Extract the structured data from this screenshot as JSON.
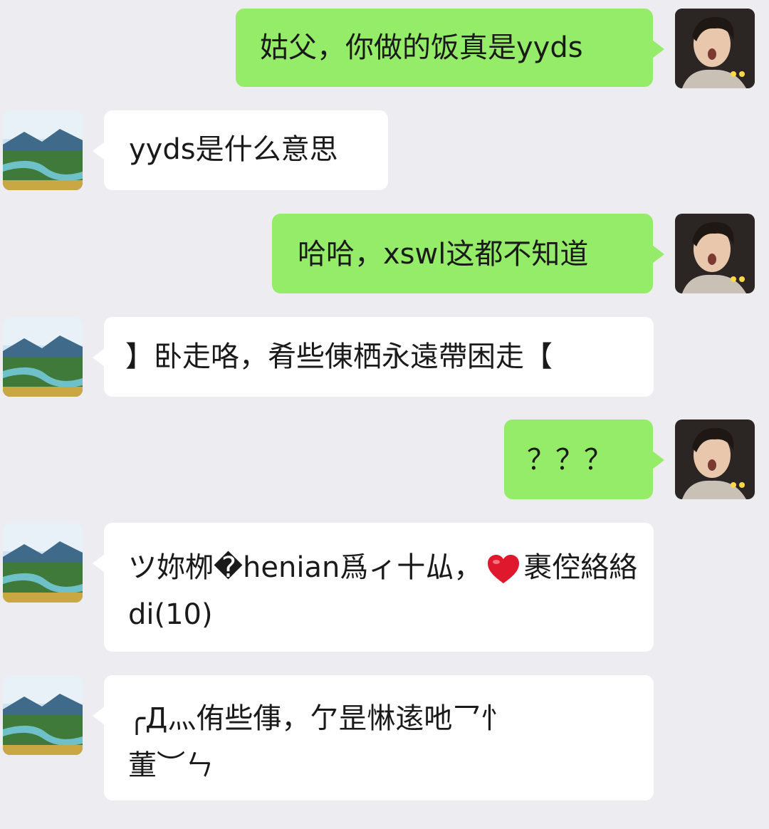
{
  "conversation": {
    "messages": [
      {
        "sender": "me",
        "lines": [
          "姑父，你做的饭真是yyds"
        ]
      },
      {
        "sender": "them",
        "lines": [
          "yyds是什么意思"
        ]
      },
      {
        "sender": "me",
        "lines": [
          "哈哈，xswl这都不知道"
        ]
      },
      {
        "sender": "them",
        "lines": [
          "】卧走咯，肴些倲栖永遠帶困走【"
        ]
      },
      {
        "sender": "me",
        "lines": [
          "？？？"
        ]
      },
      {
        "sender": "them",
        "lines": [
          "ツ妳栁�henian爲ィ十厸，",
          "裹倥絡絡",
          "di(10)"
        ]
      },
      {
        "sender": "them",
        "lines": [
          "╭Д灬侑些倳，亇昰惏逺吔乛忄",
          "董︶ㄣ"
        ]
      }
    ]
  },
  "icons": {
    "me_avatar": "boy-portrait-avatar",
    "them_avatar": "landscape-river-avatar",
    "heart": "red-heart-emoji"
  },
  "colors": {
    "background": "#ededf1",
    "me_bubble": "#95ec69",
    "them_bubble": "#ffffff",
    "heart": "#e0182e"
  }
}
